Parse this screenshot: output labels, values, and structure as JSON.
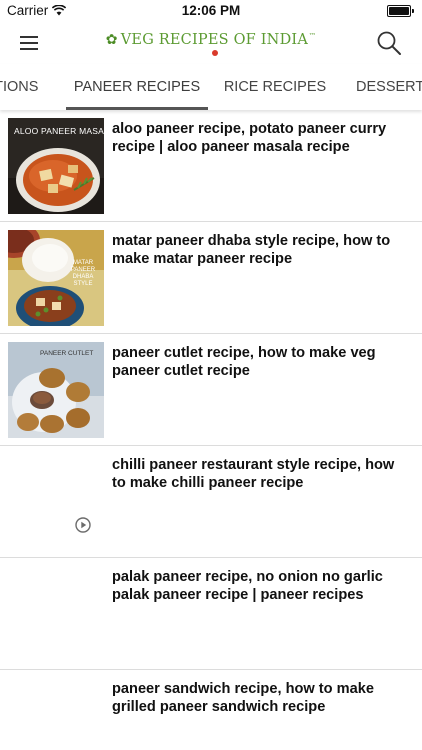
{
  "status_bar": {
    "carrier": "Carrier",
    "time": "12:06 PM"
  },
  "header": {
    "logo_text": "VEG RECIPES OF INDIA",
    "logo_tm": "™"
  },
  "tabs": [
    {
      "label": "CTIONS",
      "selected": false
    },
    {
      "label": "PANEER RECIPES",
      "selected": true
    },
    {
      "label": "RICE RECIPES",
      "selected": false
    },
    {
      "label": "DESSERT",
      "selected": false
    }
  ],
  "recipes": [
    {
      "title": "aloo paneer recipe, potato paneer curry recipe | aloo paneer masala recipe",
      "thumb_caption": "ALOO PANEER MASALA"
    },
    {
      "title": "matar paneer dhaba style recipe, how to make matar paneer recipe",
      "thumb_caption": "MATAR PANEER DHABA STYLE"
    },
    {
      "title": "paneer cutlet recipe, how to make veg paneer cutlet recipe",
      "thumb_caption": "PANEER CUTLET"
    },
    {
      "title": "chilli paneer restaurant style recipe, how to make chilli paneer recipe",
      "thumb_caption": ""
    },
    {
      "title": "palak paneer recipe, no onion no garlic palak paneer recipe | paneer recipes",
      "thumb_caption": ""
    },
    {
      "title": "paneer sandwich recipe, how to make grilled paneer sandwich recipe",
      "thumb_caption": ""
    }
  ],
  "colors": {
    "logo_green": "#5c9b32",
    "logo_dot_red": "#d93a2b",
    "tab_underline": "#555555",
    "divider": "#dcdcdc"
  },
  "icons": {
    "menu": "hamburger-menu-icon",
    "search": "search-icon",
    "play": "play-icon",
    "wifi": "wifi-icon",
    "battery": "battery-icon"
  }
}
